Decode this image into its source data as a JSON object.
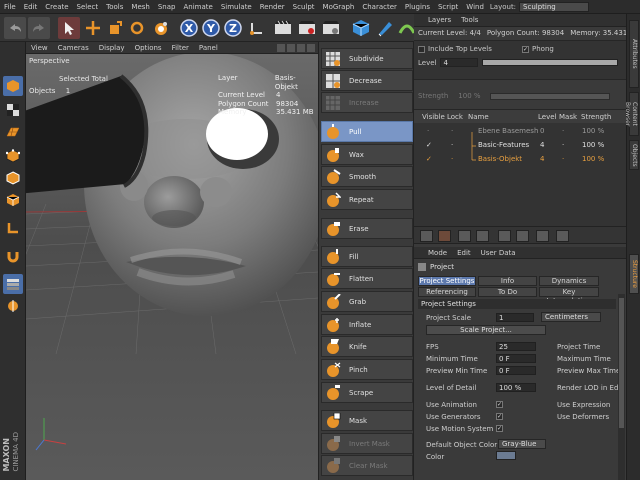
{
  "menubar": {
    "items": [
      "File",
      "Edit",
      "Create",
      "Select",
      "Tools",
      "Mesh",
      "Snap",
      "Animate",
      "Simulate",
      "Render",
      "Sculpt",
      "MoGraph",
      "Character",
      "Plugins",
      "Script",
      "Wind"
    ],
    "layout_label": "Layout:",
    "layout_value": "Sculpting"
  },
  "viewport": {
    "menu": [
      "View",
      "Cameras",
      "Display",
      "Options",
      "Filter",
      "Panel"
    ],
    "camera_label": "Perspective",
    "selected_total": "Selected Total",
    "objects_label": "Objects",
    "objects_value": "1",
    "hud": {
      "layer_label": "Layer",
      "layer_value": "Basis-Objekt",
      "level_label": "Current Level",
      "level_value": "4",
      "poly_label": "Polygon Count",
      "poly_value": "98304",
      "memory_label": "Memory",
      "memory_value": "35.431 MB"
    }
  },
  "brushes": [
    {
      "label": "Subdivide",
      "state": "normal"
    },
    {
      "label": "Decrease",
      "state": "normal"
    },
    {
      "label": "Increase",
      "state": "disabled"
    },
    {
      "label": "Pull",
      "state": "active"
    },
    {
      "label": "Wax",
      "state": "normal"
    },
    {
      "label": "Smooth",
      "state": "normal"
    },
    {
      "label": "Repeat",
      "state": "normal"
    },
    {
      "label": "Erase",
      "state": "normal"
    },
    {
      "label": "Fill",
      "state": "normal"
    },
    {
      "label": "Flatten",
      "state": "normal"
    },
    {
      "label": "Grab",
      "state": "normal"
    },
    {
      "label": "Inflate",
      "state": "normal"
    },
    {
      "label": "Knife",
      "state": "normal"
    },
    {
      "label": "Pinch",
      "state": "normal"
    },
    {
      "label": "Scrape",
      "state": "normal"
    },
    {
      "label": "Mask",
      "state": "normal"
    },
    {
      "label": "Invert Mask",
      "state": "disabled"
    },
    {
      "label": "Clear Mask",
      "state": "disabled"
    }
  ],
  "layers": {
    "tabs": [
      "Layers",
      "Tools"
    ],
    "info": {
      "current_level": "Current Level: 4/4",
      "polygon_count": "Polygon Count: 98304",
      "memory": "Memory: 35.431"
    },
    "include_top": "Include Top Levels",
    "phong": "Phong",
    "level_label": "Level",
    "level_value": "4",
    "level_fill": 1.0,
    "strength_label": "Strength",
    "strength_value": "100 %",
    "columns": [
      "Visible",
      "Lock",
      "Name",
      "Level",
      "Mask",
      "Strength"
    ],
    "rows": [
      {
        "name": "Ebene Basemesh",
        "level": "0",
        "strength": "100 %",
        "dim": true,
        "selected": false
      },
      {
        "name": "Basic-Features",
        "level": "4",
        "strength": "100 %",
        "dim": false,
        "selected": false
      },
      {
        "name": "Basis-Objekt",
        "level": "4",
        "strength": "100 %",
        "dim": false,
        "selected": true
      }
    ]
  },
  "attributes": {
    "menu": [
      "Mode",
      "Edit",
      "User Data"
    ],
    "title": "Project",
    "tabs_row1": [
      "Project Settings",
      "Info",
      "Dynamics"
    ],
    "tabs_row2": [
      "Referencing",
      "To Do",
      "Key Interpolation"
    ],
    "section": "Project Settings",
    "project_scale_label": "Project Scale",
    "project_scale_value": "1",
    "project_scale_unit": "Centimeters",
    "scale_button": "Scale Project...",
    "fps_label": "FPS",
    "fps_value": "25",
    "min_time_label": "Minimum Time",
    "min_time_value": "0 F",
    "preview_min_label": "Preview Min Time",
    "preview_min_value": "0 F",
    "project_time_label": "Project Time",
    "max_time_label": "Maximum Time",
    "preview_max_label": "Preview Max Time",
    "lod_label": "Level of Detail",
    "lod_value": "100 %",
    "render_lod_label": "Render LOD in Ed",
    "use_animation": "Use Animation",
    "use_generators": "Use Generators",
    "use_motion": "Use Motion System",
    "use_expression": "Use Expression",
    "use_deformers": "Use Deformers",
    "default_color_label": "Default Object Color",
    "default_color_value": "Gray-Blue",
    "color_label": "Color"
  },
  "side_tabs": [
    "Attributes",
    "Content Browser",
    "Objects",
    "Structure"
  ],
  "branding": {
    "brand": "MAXON",
    "product": "CINEMA 4D"
  },
  "colors": {
    "accent": "#7a96c6",
    "selected_layer": "#e8a040",
    "brush_orange": "#e8942a"
  }
}
